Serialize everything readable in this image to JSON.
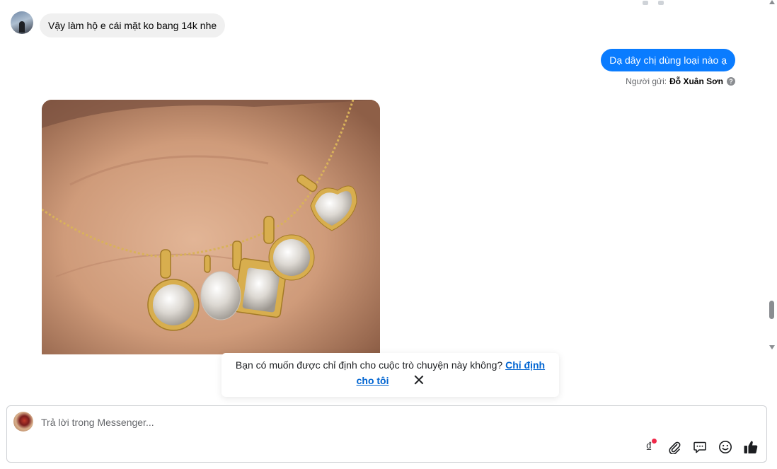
{
  "conversation": {
    "incoming_message": "Vậy làm hộ e cái mặt ko bang 14k nhe",
    "outgoing_message": "Dạ dây chị dùng loại nào ạ",
    "sender_prefix": "Người gửi:",
    "sender_name": "Đỗ Xuân Sơn",
    "help_glyph": "?",
    "image_subject": "necklace-with-diamond-pendants"
  },
  "assign_banner": {
    "question": "Bạn có muốn được chỉ định cho cuộc trò chuyện này không?",
    "link_part1": "Chỉ định",
    "link_part2": "cho tôi"
  },
  "composer": {
    "placeholder": "Trả lời trong Messenger...",
    "tools": [
      {
        "icon": "dong-currency-icon",
        "glyph": "₫",
        "has_notification_dot": true
      },
      {
        "icon": "paperclip-icon"
      },
      {
        "icon": "saved-replies-icon"
      },
      {
        "icon": "emoji-icon"
      },
      {
        "icon": "thumbs-up-icon"
      }
    ]
  },
  "colors": {
    "outgoing_bubble": "#0a7cff",
    "incoming_bubble": "#f0f0f0",
    "link": "#0064d1",
    "notification_dot": "#f02849"
  }
}
